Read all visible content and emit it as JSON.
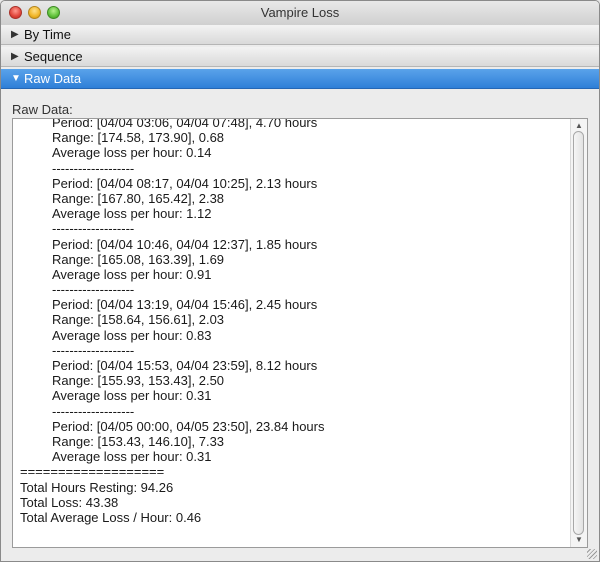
{
  "window": {
    "title": "Vampire Loss"
  },
  "sections": [
    {
      "label": "By Time",
      "expanded": false
    },
    {
      "label": "Sequence",
      "expanded": false
    },
    {
      "label": "Raw Data",
      "expanded": true
    }
  ],
  "raw_data_label": "Raw Data:",
  "raw_lines": [
    {
      "text": "Period: [04/04 03:06, 04/04 07:48], 4.70 hours",
      "indent": true
    },
    {
      "text": "Range: [174.58, 173.90], 0.68",
      "indent": true
    },
    {
      "text": "Average loss per hour: 0.14",
      "indent": true
    },
    {
      "text": "-------------------",
      "indent": true
    },
    {
      "text": "Period: [04/04 08:17, 04/04 10:25], 2.13 hours",
      "indent": true
    },
    {
      "text": "Range: [167.80, 165.42], 2.38",
      "indent": true
    },
    {
      "text": "Average loss per hour: 1.12",
      "indent": true
    },
    {
      "text": "-------------------",
      "indent": true
    },
    {
      "text": "Period: [04/04 10:46, 04/04 12:37], 1.85 hours",
      "indent": true
    },
    {
      "text": "Range: [165.08, 163.39], 1.69",
      "indent": true
    },
    {
      "text": "Average loss per hour: 0.91",
      "indent": true
    },
    {
      "text": "-------------------",
      "indent": true
    },
    {
      "text": "Period: [04/04 13:19, 04/04 15:46], 2.45 hours",
      "indent": true
    },
    {
      "text": "Range: [158.64, 156.61], 2.03",
      "indent": true
    },
    {
      "text": "Average loss per hour: 0.83",
      "indent": true
    },
    {
      "text": "-------------------",
      "indent": true
    },
    {
      "text": "Period: [04/04 15:53, 04/04 23:59], 8.12 hours",
      "indent": true
    },
    {
      "text": "Range: [155.93, 153.43], 2.50",
      "indent": true
    },
    {
      "text": "Average loss per hour: 0.31",
      "indent": true
    },
    {
      "text": "-------------------",
      "indent": true
    },
    {
      "text": "Period: [04/05 00:00, 04/05 23:50], 23.84 hours",
      "indent": true
    },
    {
      "text": "Range: [153.43, 146.10], 7.33",
      "indent": true
    },
    {
      "text": "Average loss per hour: 0.31",
      "indent": true
    },
    {
      "text": "===================",
      "indent": false
    },
    {
      "text": "Total Hours Resting: 94.26",
      "indent": false
    },
    {
      "text": "Total Loss: 43.38",
      "indent": false
    },
    {
      "text": "Total Average Loss / Hour: 0.46",
      "indent": false
    }
  ],
  "icons": {
    "collapsed": "▶",
    "expanded": "▼",
    "scroll_up": "▲",
    "scroll_down": "▼"
  },
  "colors": {
    "accent": "#2f7fd8"
  }
}
